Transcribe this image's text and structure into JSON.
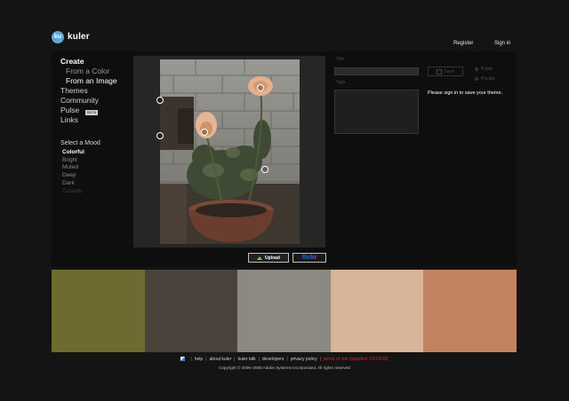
{
  "header": {
    "logo_mark": "ku",
    "app_name": "kuler",
    "register_label": "Register",
    "signin_label": "Sign in"
  },
  "nav": {
    "create": "Create",
    "from_color": "From a Color",
    "from_image": "From an Image",
    "themes": "Themes",
    "community": "Community",
    "pulse": "Pulse",
    "pulse_badge": "BETA",
    "links": "Links"
  },
  "mood": {
    "heading": "Select a Mood",
    "options": [
      "Colorful",
      "Bright",
      "Muted",
      "Deep",
      "Dark",
      "Custom"
    ],
    "selected": "Colorful"
  },
  "upload": {
    "upload_label": "Upload",
    "flickr_part1": "flick",
    "flickr_part2": "r"
  },
  "form": {
    "title_label": "Title",
    "tags_label": "Tags",
    "save_label": "Save",
    "public_label": "Public",
    "private_label": "Private",
    "signin_message": "Please sign in to save your theme."
  },
  "palette": [
    "#6e6a32",
    "#4a433c",
    "#8c8983",
    "#d8b598",
    "#c08462"
  ],
  "footer": {
    "help": "help",
    "about": "about kuler",
    "talk": "kuler talk",
    "developers": "developers",
    "privacy": "privacy policy",
    "terms": "terms of use (updated: 10/19/08)",
    "copyright": "Copyright © 2006–2008 Adobe Systems Incorporated. All rights reserved"
  }
}
